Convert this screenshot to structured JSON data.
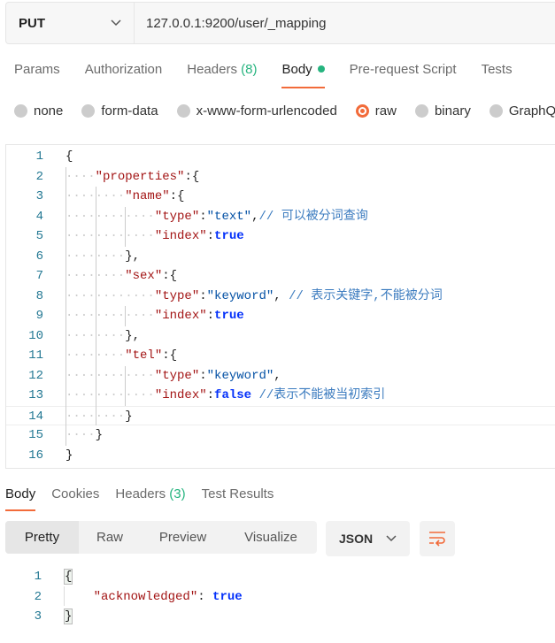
{
  "request": {
    "method": "PUT",
    "url": "127.0.0.1:9200/user/_mapping"
  },
  "tabs": [
    {
      "label": "Params"
    },
    {
      "label": "Authorization"
    },
    {
      "label": "Headers",
      "count": "(8)"
    },
    {
      "label": "Body",
      "active": true,
      "dot": true
    },
    {
      "label": "Pre-request Script"
    },
    {
      "label": "Tests"
    }
  ],
  "body_types": [
    {
      "label": "none"
    },
    {
      "label": "form-data"
    },
    {
      "label": "x-www-form-urlencoded"
    },
    {
      "label": "raw",
      "selected": true
    },
    {
      "label": "binary"
    },
    {
      "label": "GraphQL"
    }
  ],
  "colors": {
    "accent": "#f26b3a",
    "green": "#26b47f"
  },
  "editor_lines": [
    {
      "indent": 0,
      "tokens": [
        [
          "p",
          "{"
        ]
      ]
    },
    {
      "indent": 1,
      "tokens": [
        [
          "k",
          "\"properties\""
        ],
        [
          "p",
          ":{"
        ]
      ]
    },
    {
      "indent": 2,
      "tokens": [
        [
          "k",
          "\"name\""
        ],
        [
          "p",
          ":{"
        ]
      ]
    },
    {
      "indent": 3,
      "tokens": [
        [
          "k",
          "\"type\""
        ],
        [
          "p",
          ":"
        ],
        [
          "s",
          "\"text\""
        ],
        [
          "p",
          ","
        ],
        [
          "c",
          "// 可以被分词查询"
        ]
      ]
    },
    {
      "indent": 3,
      "tokens": [
        [
          "k",
          "\"index\""
        ],
        [
          "p",
          ":"
        ],
        [
          "b",
          "true"
        ]
      ]
    },
    {
      "indent": 2,
      "tokens": [
        [
          "p",
          "},"
        ]
      ]
    },
    {
      "indent": 2,
      "tokens": [
        [
          "k",
          "\"sex\""
        ],
        [
          "p",
          ":{"
        ]
      ]
    },
    {
      "indent": 3,
      "tokens": [
        [
          "k",
          "\"type\""
        ],
        [
          "p",
          ":"
        ],
        [
          "s",
          "\"keyword\""
        ],
        [
          "p",
          ", "
        ],
        [
          "c",
          "// 表示关键字,不能被分词"
        ]
      ]
    },
    {
      "indent": 3,
      "tokens": [
        [
          "k",
          "\"index\""
        ],
        [
          "p",
          ":"
        ],
        [
          "b",
          "true"
        ]
      ]
    },
    {
      "indent": 2,
      "tokens": [
        [
          "p",
          "},"
        ]
      ]
    },
    {
      "indent": 2,
      "tokens": [
        [
          "k",
          "\"tel\""
        ],
        [
          "p",
          ":{"
        ]
      ]
    },
    {
      "indent": 3,
      "tokens": [
        [
          "k",
          "\"type\""
        ],
        [
          "p",
          ":"
        ],
        [
          "s",
          "\"keyword\""
        ],
        [
          "p",
          ","
        ]
      ]
    },
    {
      "indent": 3,
      "tokens": [
        [
          "k",
          "\"index\""
        ],
        [
          "p",
          ":"
        ],
        [
          "b",
          "false"
        ],
        [
          "p",
          " "
        ],
        [
          "c",
          "//表示不能被当初索引"
        ]
      ]
    },
    {
      "indent": 2,
      "tokens": [
        [
          "p",
          "}"
        ]
      ]
    },
    {
      "indent": 1,
      "tokens": [
        [
          "p",
          "}"
        ]
      ]
    },
    {
      "indent": 0,
      "tokens": [
        [
          "p",
          "}"
        ]
      ]
    }
  ],
  "response": {
    "tabs": [
      {
        "label": "Body",
        "active": true
      },
      {
        "label": "Cookies"
      },
      {
        "label": "Headers",
        "count": "(3)"
      },
      {
        "label": "Test Results"
      }
    ],
    "views": [
      "Pretty",
      "Raw",
      "Preview",
      "Visualize"
    ],
    "active_view": "Pretty",
    "format": "JSON",
    "lines": [
      {
        "tokens": [
          [
            "p",
            "{"
          ]
        ]
      },
      {
        "tokens": [
          [
            "p",
            "    "
          ],
          [
            "k",
            "\"acknowledged\""
          ],
          [
            "p",
            ": "
          ],
          [
            "b",
            "true"
          ]
        ]
      },
      {
        "tokens": [
          [
            "p",
            "}"
          ]
        ]
      }
    ]
  }
}
